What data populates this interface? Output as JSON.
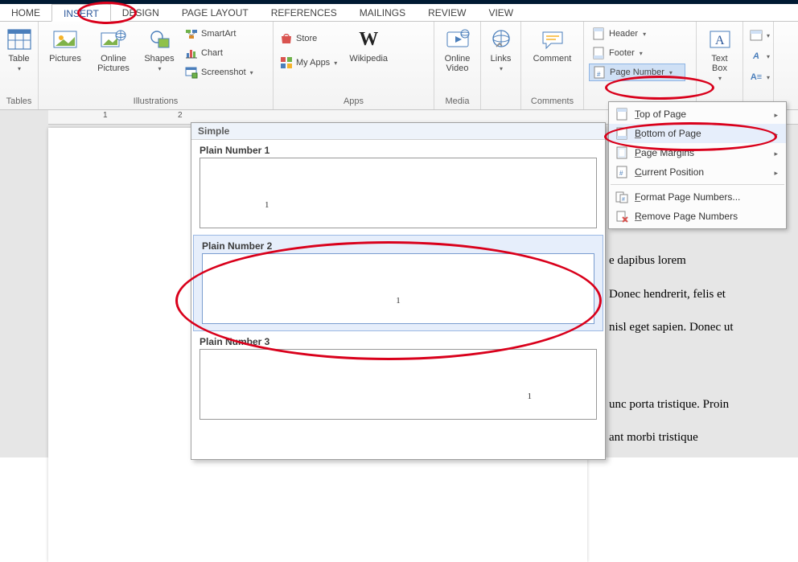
{
  "tabs": {
    "home": "HOME",
    "insert": "INSERT",
    "design": "DESIGN",
    "page_layout": "PAGE LAYOUT",
    "references": "REFERENCES",
    "mailings": "MAILINGS",
    "review": "REVIEW",
    "view": "VIEW"
  },
  "ribbon": {
    "tables": {
      "table_btn": "Table",
      "group": "Tables"
    },
    "illustrations": {
      "pictures": "Pictures",
      "online_pictures": "Online\nPictures",
      "shapes": "Shapes",
      "smartart": "SmartArt",
      "chart": "Chart",
      "screenshot": "Screenshot",
      "group": "Illustrations"
    },
    "apps": {
      "store": "Store",
      "my_apps": "My Apps",
      "wikipedia": "Wikipedia",
      "group": "Apps"
    },
    "media": {
      "online_video": "Online\nVideo",
      "group": "Media"
    },
    "links": {
      "links": "Links"
    },
    "comments": {
      "comment": "Comment",
      "group": "Comments"
    },
    "header_footer": {
      "header": "Header",
      "footer": "Footer",
      "page_number": "Page Number"
    },
    "text": {
      "text_box": "Text\nBox"
    }
  },
  "page_number_menu": {
    "top": "Top of Page",
    "bottom": "Bottom of Page",
    "margins": "Page Margins",
    "current": "Current Position",
    "format": "Format Page Numbers...",
    "remove": "Remove Page Numbers"
  },
  "gallery": {
    "header": "Simple",
    "items": [
      {
        "title": "Plain Number 1",
        "align": "left",
        "num": "1"
      },
      {
        "title": "Plain Number 2",
        "align": "center",
        "num": "1"
      },
      {
        "title": "Plain Number 3",
        "align": "right",
        "num": "1"
      }
    ],
    "selected_index": 1
  },
  "ruler": {
    "mark1": "1",
    "mark2": "2"
  },
  "doc_frags": {
    "a": "e dapibus lorem",
    "b": "Donec hendrerit, felis et",
    "c": "nisl eget sapien. Donec ut",
    "d": "unc porta tristique. Proin",
    "e": "ant morbi tristique"
  }
}
